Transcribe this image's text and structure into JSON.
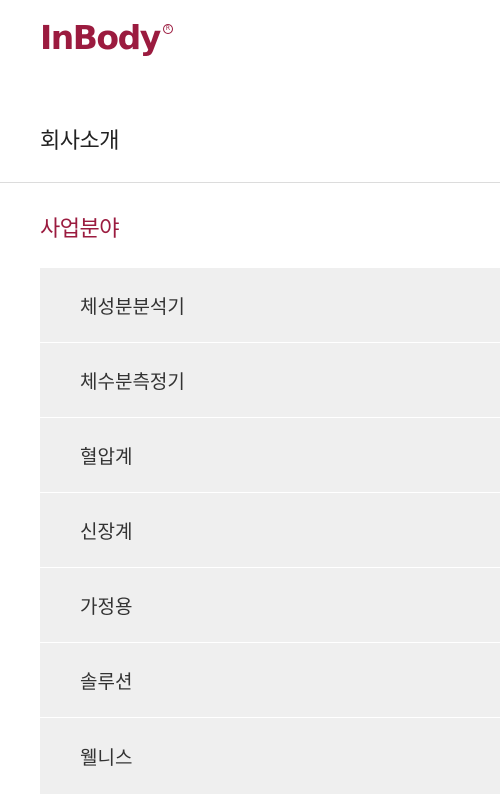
{
  "brand": {
    "logo_text": "InBody",
    "registered_mark": "R",
    "accent_color": "#9b1b3f"
  },
  "nav": {
    "items": [
      {
        "label": "회사소개",
        "active": false
      },
      {
        "label": "사업분야",
        "active": true
      }
    ],
    "submenu": [
      {
        "label": "체성분분석기"
      },
      {
        "label": "체수분측정기"
      },
      {
        "label": "혈압계"
      },
      {
        "label": "신장계"
      },
      {
        "label": "가정용"
      },
      {
        "label": "솔루션"
      },
      {
        "label": "웰니스"
      }
    ]
  }
}
